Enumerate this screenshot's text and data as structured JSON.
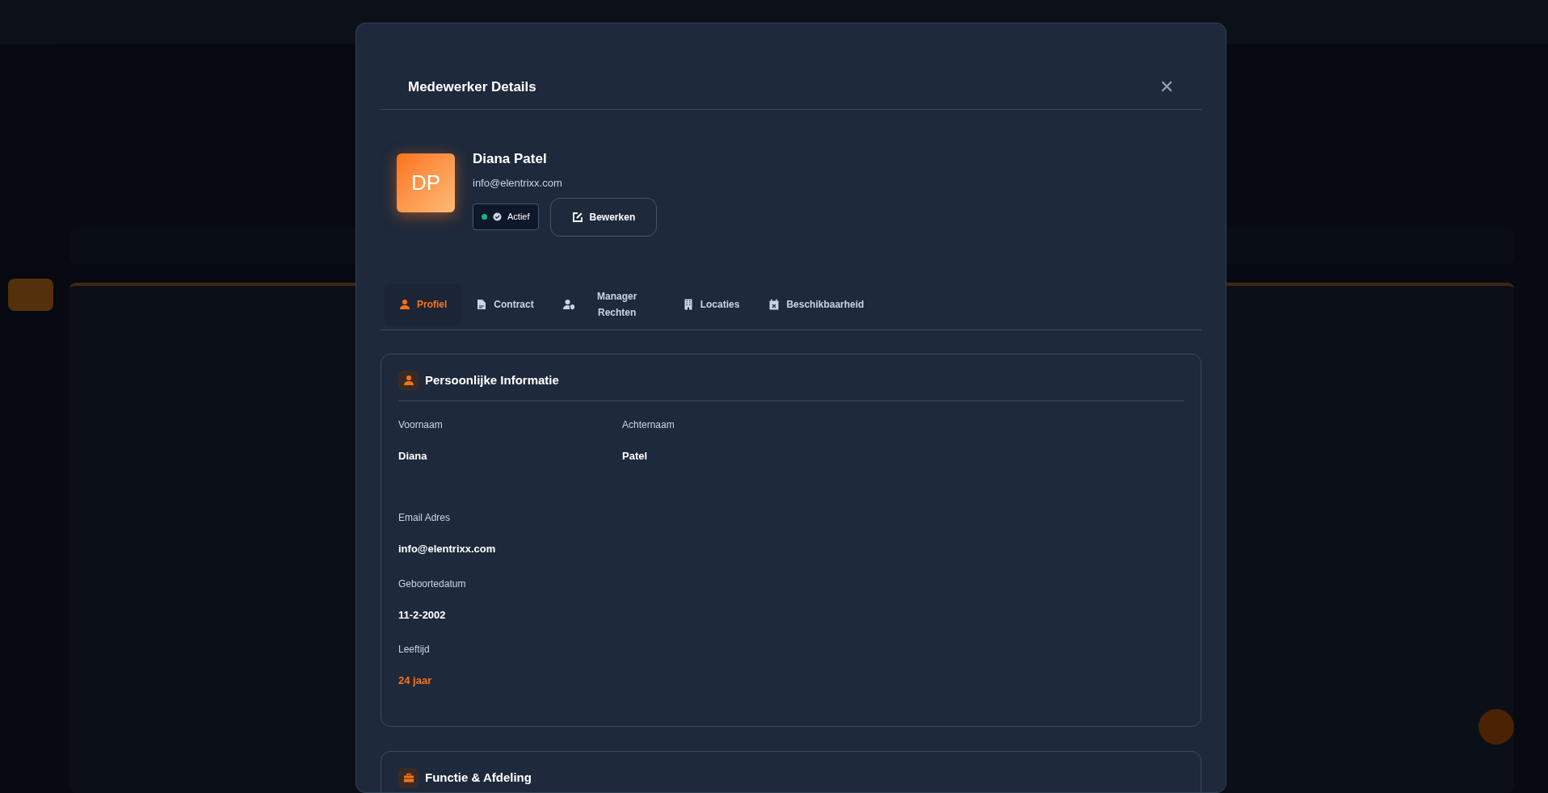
{
  "modal": {
    "title": "Medewerker Details",
    "close": "✕"
  },
  "employee": {
    "initials": "DP",
    "name": "Diana Patel",
    "email": "info@elentrixx.com",
    "status": {
      "label": "Actief",
      "active": true
    },
    "edit_button": "Bewerken"
  },
  "tabs": [
    {
      "label": "Profiel",
      "selected": true
    },
    {
      "label": "Contract",
      "selected": false
    },
    {
      "label": "Manager Rechten",
      "selected": false
    },
    {
      "label": "Locaties",
      "selected": false
    },
    {
      "label": "Beschikbaarheid",
      "selected": false
    }
  ],
  "sections": [
    {
      "title": "Persoonlijke Informatie",
      "fields": [
        {
          "label": "Voornaam",
          "value": "Diana",
          "kind": "half"
        },
        {
          "label": "Achternaam",
          "value": "Patel",
          "kind": "half"
        },
        {
          "label": "Email Adres",
          "value": "info@elentrixx.com",
          "kind": "full"
        },
        {
          "label": "Geboortedatum",
          "value": "11-2-2002",
          "kind": "full"
        },
        {
          "label": "Leeftijd",
          "value": "24 jaar",
          "kind": "highlight"
        }
      ]
    },
    {
      "title": "Functie & Afdeling"
    }
  ]
}
